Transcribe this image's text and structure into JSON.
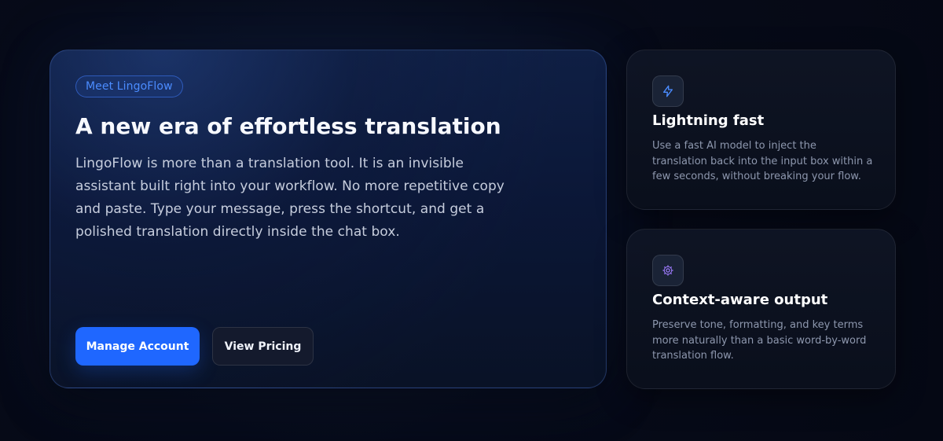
{
  "hero": {
    "badge": "Meet LingoFlow",
    "title": "A new era of effortless translation",
    "description": "LingoFlow is more than a translation tool. It is an invisible assistant built right into your workflow. No more repetitive copy and paste. Type your message, press the shortcut, and get a polished translation directly inside the chat box.",
    "primary_button": "Manage Account",
    "secondary_button": "View Pricing"
  },
  "features": [
    {
      "icon": "lightning-icon",
      "icon_color": "#4b8cff",
      "title": "Lightning fast",
      "description": "Use a fast AI model to inject the translation back into the input box within a few seconds, without breaking your flow."
    },
    {
      "icon": "gear-icon",
      "icon_color": "#9f7cff",
      "title": "Context-aware output",
      "description": "Preserve tone, formatting, and key terms more naturally than a basic word-by-word translation flow."
    }
  ],
  "colors": {
    "primary": "#1f67ff",
    "badge_text": "#4b8cff",
    "background": "#050814"
  }
}
